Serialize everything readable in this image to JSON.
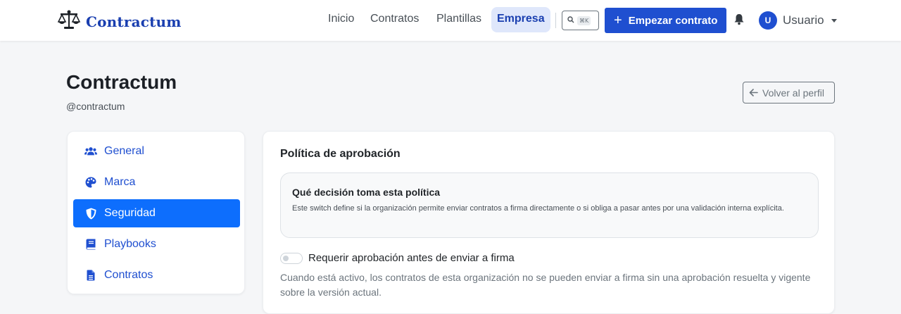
{
  "brand": {
    "name": "Contractum",
    "color": "#1a3fb0"
  },
  "nav": {
    "links": [
      "Inicio",
      "Contratos",
      "Plantillas",
      "Empresa"
    ],
    "active": "Empresa",
    "search_shortcut": "⌘K",
    "start_button": "Empezar contrato",
    "user": {
      "initial": "U",
      "name": "Usuario"
    }
  },
  "header": {
    "title": "Contractum",
    "handle": "@contractum",
    "back_button": "Volver al perfil"
  },
  "sidebar": {
    "items": [
      {
        "label": "General",
        "icon": "users-icon",
        "active": false
      },
      {
        "label": "Marca",
        "icon": "palette-icon",
        "active": false
      },
      {
        "label": "Seguridad",
        "icon": "shield-icon",
        "active": true
      },
      {
        "label": "Playbooks",
        "icon": "book-icon",
        "active": false
      },
      {
        "label": "Contratos",
        "icon": "file-icon",
        "active": false
      }
    ]
  },
  "main": {
    "section_title": "Política de aprobación",
    "info": {
      "title": "Qué decisión toma esta política",
      "text": "Este switch define si la organización permite enviar contratos a firma directamente o si obliga a pasar antes por una validación interna explícita."
    },
    "switch": {
      "label": "Requerir aprobación antes de enviar a firma",
      "checked": false
    },
    "help": "Cuando está activo, los contratos de esta organización no se pueden enviar a firma sin una aprobación resuelta y vigente sobre la versión actual."
  },
  "colors": {
    "primary": "#1f4fd0",
    "active_item": "#0d6efd",
    "nav_active_bg": "#dfe7fb"
  }
}
